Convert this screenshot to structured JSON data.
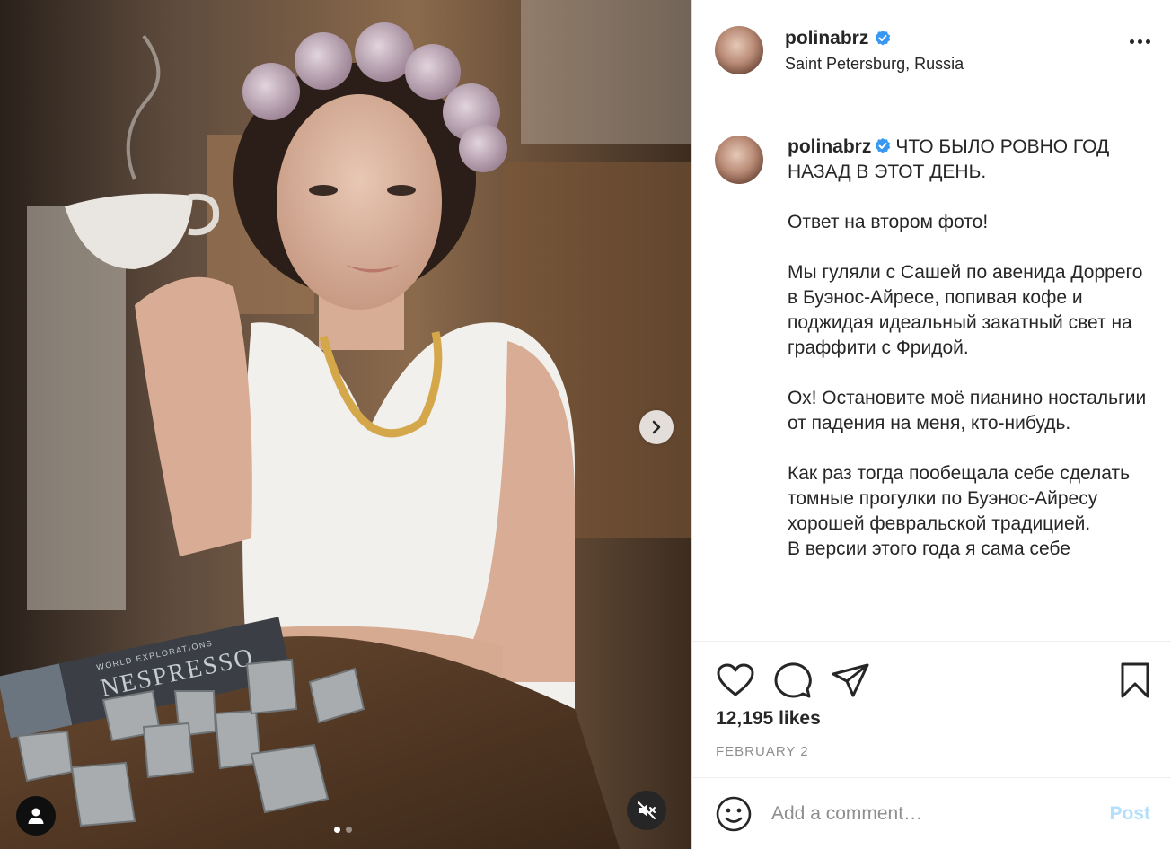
{
  "post": {
    "username": "polinabrz",
    "location": "Saint Petersburg, Russia",
    "caption_text": "ЧТО БЫЛО РОВНО ГОД НАЗАД В ЭТОТ ДЕНЬ.\n\nОтвет на втором фото!\n\nМы гуляли с Сашей по авенида Доррего в Буэнос-Айресе, попивая кофе и поджидая идеальный закатный свет на граффити с Фридой.\n\nОх! Остановите моё пианино ностальгии от падения на меня, кто-нибудь.\n\nКак раз тогда пообещала себе сделать томные прогулки по Буэнос-Айресу хорошей февральской традицией.\nВ версии этого года я сама себе",
    "likes": "12,195 likes",
    "date": "FEBRUARY 2"
  },
  "comment": {
    "placeholder": "Add a comment…",
    "post_label": "Post"
  },
  "media": {
    "box_text": "NESPRESSO",
    "box_subtext": "WORLD EXPLORATIONS",
    "carousel_count": 2,
    "carousel_active": 1
  },
  "colors": {
    "verified": "#3897f0",
    "post_disabled": "#b2dffc",
    "text": "#262626",
    "muted": "#8e8e8e"
  },
  "icons": [
    "verified-icon",
    "more-icon",
    "heart-icon",
    "comment-icon",
    "share-icon",
    "bookmark-icon",
    "emoji-icon",
    "user-tag-icon",
    "mute-icon",
    "chevron-right-icon"
  ]
}
